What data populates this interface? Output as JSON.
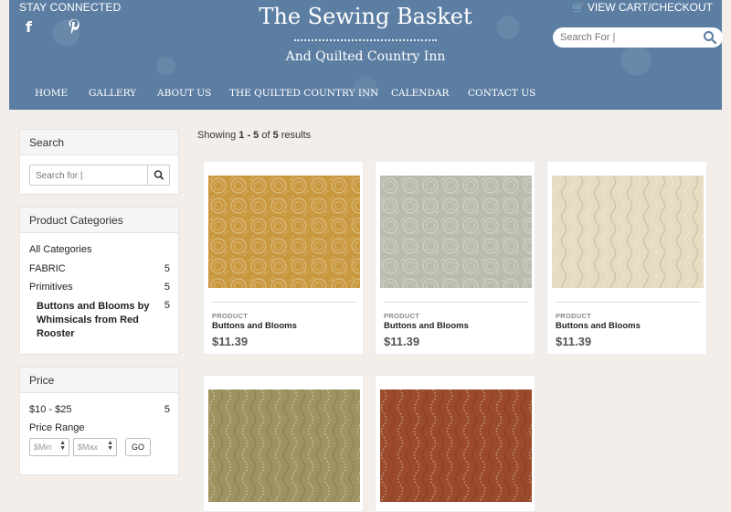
{
  "header": {
    "stay_connected": "STAY CONNECTED",
    "facebook_glyph": "f",
    "pinterest_glyph": "P",
    "site_title": "The Sewing Basket",
    "site_subtitle": "And Quilted Country Inn",
    "cart_label": "VIEW CART/CHECKOUT",
    "search_placeholder": "Search For |",
    "background_color": "#5d7ea3"
  },
  "nav": {
    "items": [
      {
        "label": "HOME"
      },
      {
        "label": "GALLERY"
      },
      {
        "label": "ABOUT US"
      },
      {
        "label": "THE QUILTED COUNTRY INN"
      },
      {
        "label": "CALENDAR"
      },
      {
        "label": "CONTACT US"
      }
    ]
  },
  "sidebar": {
    "search": {
      "title": "Search",
      "placeholder": "Search for |"
    },
    "categories": {
      "title": "Product Categories",
      "items": [
        {
          "label": "All Categories",
          "count": ""
        },
        {
          "label": "FABRIC",
          "count": "5"
        },
        {
          "label": "Primitives",
          "count": "5"
        },
        {
          "label": "Buttons and Blooms by Whimsicals from Red Rooster",
          "count": "5"
        }
      ]
    },
    "price": {
      "title": "Price",
      "range_label": "$10 - $25",
      "range_count": "5",
      "price_range_label": "Price Range",
      "min_placeholder": "$Min",
      "max_placeholder": "$Max",
      "go_label": "GO"
    }
  },
  "results": {
    "prefix": "Showing ",
    "range": "1 - 5",
    "of": " of ",
    "total": "5",
    "suffix": " results"
  },
  "products": [
    {
      "kind": "PRODUCT",
      "name": "Buttons and Blooms",
      "price": "$11.39",
      "swatch": "#c9983f"
    },
    {
      "kind": "PRODUCT",
      "name": "Buttons and Blooms",
      "price": "$11.39",
      "swatch": "#b9bcad"
    },
    {
      "kind": "PRODUCT",
      "name": "Buttons and Blooms",
      "price": "$11.39",
      "swatch": "#e6dcc2"
    },
    {
      "kind": "",
      "name": "",
      "price": "",
      "swatch": "#9e9461"
    },
    {
      "kind": "",
      "name": "",
      "price": "",
      "swatch": "#9b4a2c"
    }
  ]
}
